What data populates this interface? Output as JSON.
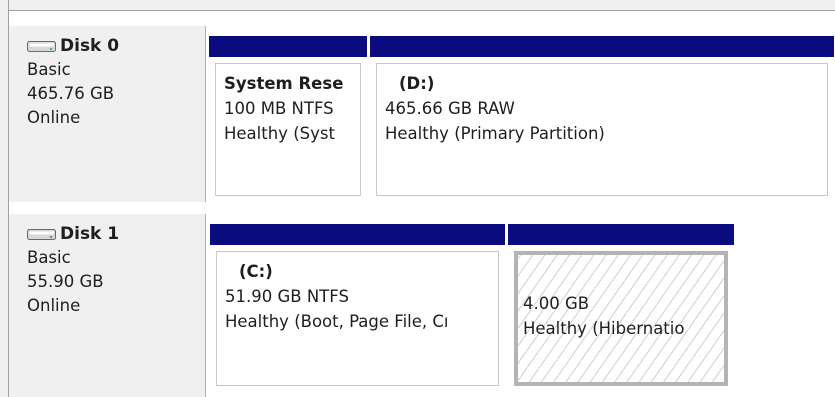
{
  "disks": [
    {
      "name": "Disk 0",
      "type": "Basic",
      "size": "465.76 GB",
      "status": "Online",
      "icon": "hard-disk-icon",
      "partitions": [
        {
          "title": "System Rese",
          "size": "100 MB NTFS",
          "status": "Healthy (Syst"
        },
        {
          "title": "(D:)",
          "size": "465.66 GB RAW",
          "status": "Healthy (Primary Partition)"
        }
      ]
    },
    {
      "name": "Disk 1",
      "type": "Basic",
      "size": "55.90 GB",
      "status": "Online",
      "icon": "hard-disk-icon",
      "partitions": [
        {
          "title": "(C:)",
          "size": "51.90 GB NTFS",
          "status": "Healthy (Boot, Page File, Cı"
        },
        {
          "title": "",
          "size": "4.00 GB",
          "status": "Healthy (Hibernatio"
        }
      ]
    }
  ],
  "colors": {
    "partition_header": "#0b0b80",
    "label_background": "#f0f0f0",
    "selection_border": "#b4b4b4"
  }
}
